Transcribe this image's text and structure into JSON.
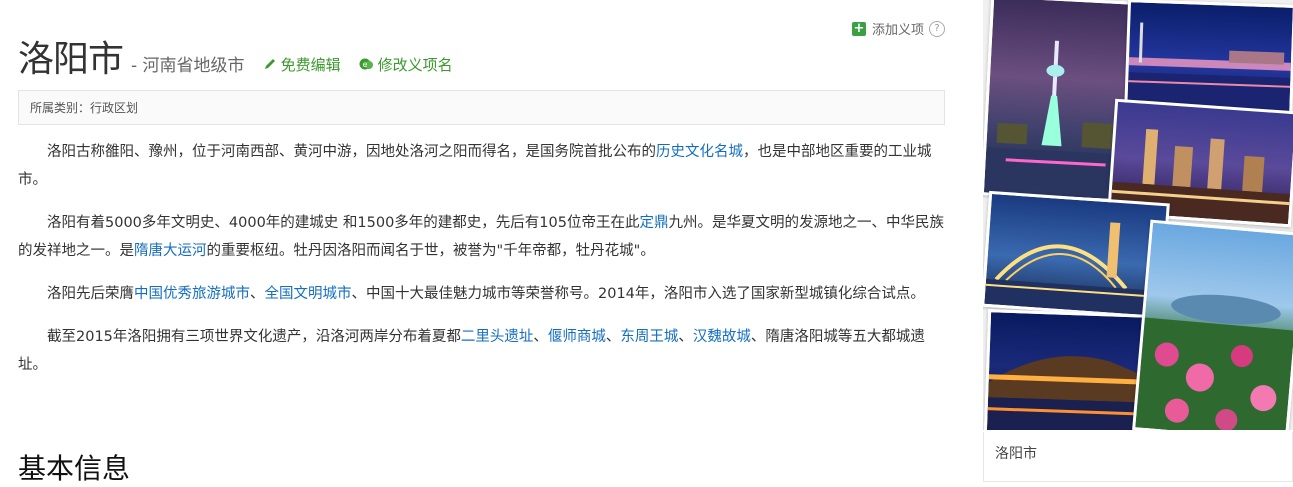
{
  "toolbar": {
    "add_item": "添加义项",
    "help": "?"
  },
  "header": {
    "title": "洛阳市",
    "subtitle": "- 河南省地级市",
    "edit_label": "免费编辑",
    "rename_label": "修改义项名"
  },
  "category": {
    "text": "所属类别：行政区划"
  },
  "paragraphs": [
    {
      "segments": [
        {
          "t": "洛阳古称雒阳、豫州，位于河南西部、黄河中游，因地处洛河之阳而得名，是国务院首批公布的"
        },
        {
          "t": "历史文化名城",
          "link": true
        },
        {
          "t": "，也是中部地区重要的工业城市。"
        }
      ]
    },
    {
      "segments": [
        {
          "t": "洛阳有着5000多年文明史、4000年的建城史 和1500多年的建都史，先后有105位帝王在此"
        },
        {
          "t": "定鼎",
          "link": true
        },
        {
          "t": "九州。是华夏文明的发源地之一、中华民族的发祥地之一。是"
        },
        {
          "t": "隋唐大运河",
          "link": true
        },
        {
          "t": "的重要枢纽。牡丹因洛阳而闻名于世，被誉为\"千年帝都，牡丹花城\"。"
        }
      ]
    },
    {
      "segments": [
        {
          "t": "洛阳先后荣膺"
        },
        {
          "t": "中国优秀旅游城市",
          "link": true
        },
        {
          "t": "、"
        },
        {
          "t": "全国文明城市",
          "link": true
        },
        {
          "t": "、中国十大最佳魅力城市等荣誉称号。2014年，洛阳市入选了国家新型城镇化综合试点。"
        }
      ]
    },
    {
      "segments": [
        {
          "t": "截至2015年洛阳拥有三项世界文化遗产，沿洛河两岸分布着夏都"
        },
        {
          "t": "二里头遗址",
          "link": true
        },
        {
          "t": "、"
        },
        {
          "t": "偃师商城",
          "link": true
        },
        {
          "t": "、"
        },
        {
          "t": "东周王城",
          "link": true
        },
        {
          "t": "、"
        },
        {
          "t": "汉魏故城",
          "link": true
        },
        {
          "t": "、隋唐洛阳城等五大都城遗址。"
        }
      ]
    }
  ],
  "section": {
    "title": "基本信息"
  },
  "sidebar": {
    "caption": "洛阳市"
  },
  "colors": {
    "link": "#136ec2",
    "accent_green": "#3b9a2d"
  }
}
